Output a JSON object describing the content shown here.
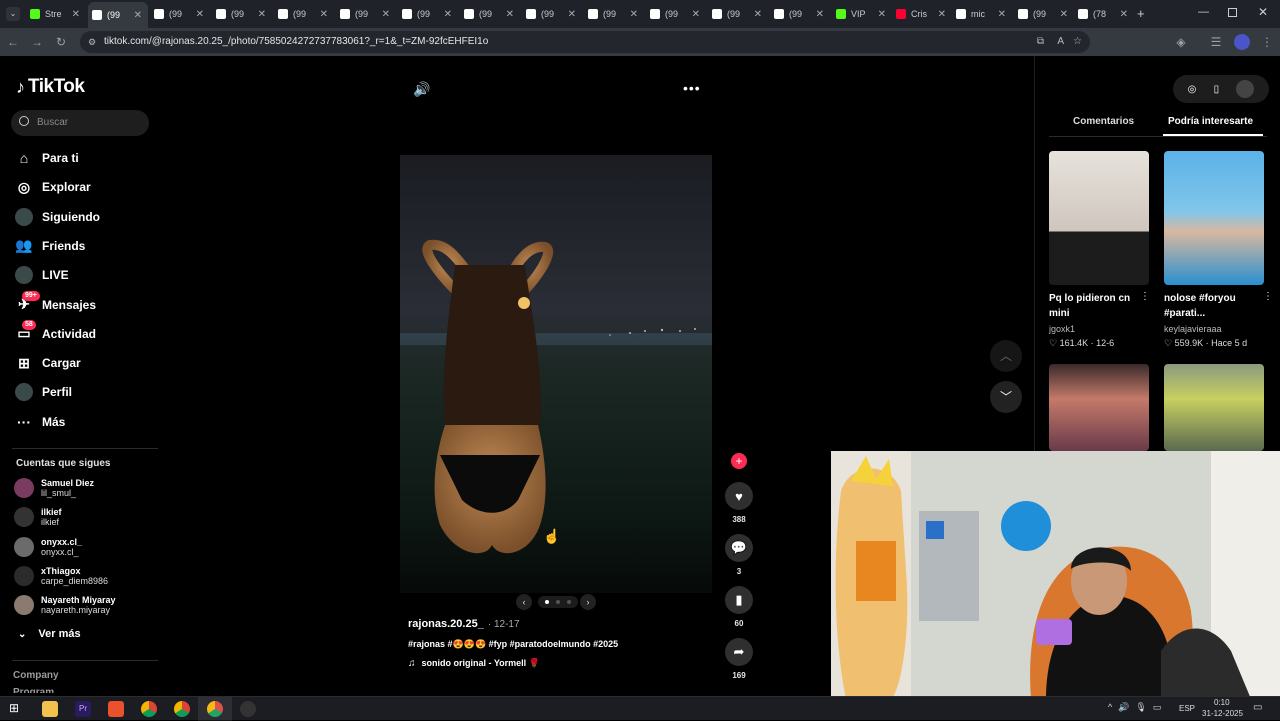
{
  "browser": {
    "tabs": [
      {
        "label": "Stre",
        "color": "#53fc18"
      },
      {
        "label": "(99",
        "color": "#ffffff",
        "active": true
      },
      {
        "label": "(99",
        "color": "#ffffff"
      },
      {
        "label": "(99",
        "color": "#ffffff"
      },
      {
        "label": "(99",
        "color": "#ffffff"
      },
      {
        "label": "(99",
        "color": "#ffffff"
      },
      {
        "label": "(99",
        "color": "#ffffff"
      },
      {
        "label": "(99",
        "color": "#ffffff"
      },
      {
        "label": "(99",
        "color": "#ffffff"
      },
      {
        "label": "(99",
        "color": "#ffffff"
      },
      {
        "label": "(99",
        "color": "#ffffff"
      },
      {
        "label": "(99",
        "color": "#ffffff"
      },
      {
        "label": "(99",
        "color": "#ffffff"
      },
      {
        "label": "VIP",
        "color": "#53fc18"
      },
      {
        "label": "Cris",
        "color": "#ff0033"
      },
      {
        "label": "mic",
        "color": "#ffffff"
      },
      {
        "label": "(99",
        "color": "#ffffff"
      },
      {
        "label": "(78",
        "color": "#ffffff"
      }
    ],
    "url": "tiktok.com/@rajonas.20.25_/photo/7585024272737783061?_r=1&_t=ZM-92fcEHFEI1o"
  },
  "tiktok": {
    "logo": "TikTok",
    "search_placeholder": "Buscar",
    "nav": [
      {
        "label": "Para ti",
        "icon": "home-icon",
        "glyph": "⌂"
      },
      {
        "label": "Explorar",
        "icon": "compass-icon",
        "glyph": "◎"
      },
      {
        "label": "Siguiendo",
        "icon": "following-avatar-icon",
        "glyph": ""
      },
      {
        "label": "Friends",
        "icon": "friends-icon",
        "glyph": "👥"
      },
      {
        "label": "LIVE",
        "icon": "live-icon",
        "glyph": ""
      },
      {
        "label": "Mensajes",
        "icon": "messages-icon",
        "glyph": "✈",
        "badge": "99+"
      },
      {
        "label": "Actividad",
        "icon": "activity-icon",
        "glyph": "▭",
        "badge": "58"
      },
      {
        "label": "Cargar",
        "icon": "upload-icon",
        "glyph": "⊞"
      },
      {
        "label": "Perfil",
        "icon": "profile-avatar-icon",
        "glyph": ""
      },
      {
        "label": "Más",
        "icon": "more-icon",
        "glyph": "···"
      }
    ],
    "following_title": "Cuentas que sigues",
    "following": [
      {
        "name": "Samuel Diez",
        "handle": "lil_smul_",
        "color": "#7a3b60"
      },
      {
        "name": "ilkief",
        "handle": "ilkief",
        "color": "#333333"
      },
      {
        "name": "onyxx.cl_",
        "handle": "onyxx.cl_",
        "color": "#6b6b6b"
      },
      {
        "name": "xThiagox",
        "handle": "carpe_diem8986",
        "color": "#2b2b2b"
      },
      {
        "name": "Nayareth Miyaray",
        "handle": "nayareth.miyaray",
        "color": "#8a7a70"
      }
    ],
    "see_more": "Ver más",
    "company": "Company",
    "program": "Program",
    "post": {
      "author": "rajonas.20.25_",
      "date": "· 12-17",
      "caption": "#rajonas #😍😍😍 #fyp #paratodoelmundo #2025",
      "sound": "sonido original - Yormell 🌹",
      "likes": "388",
      "comments": "3",
      "saves": "60",
      "shares": "169"
    },
    "right_tabs": {
      "comments": "Comentarios",
      "recommended": "Podría interesarte"
    },
    "recommended": [
      {
        "title": "Pq lo pidieron cn mini",
        "user": "jgoxk1",
        "likes": "161.4K",
        "date": "12-6"
      },
      {
        "title": "nolose #foryou #parati...",
        "user": "keylajavieraaa",
        "likes": "559.9K",
        "date": "Hace 5 d"
      }
    ]
  },
  "taskbar": {
    "lang": "ESP",
    "time": "0:10",
    "date": "31-12-2025"
  }
}
